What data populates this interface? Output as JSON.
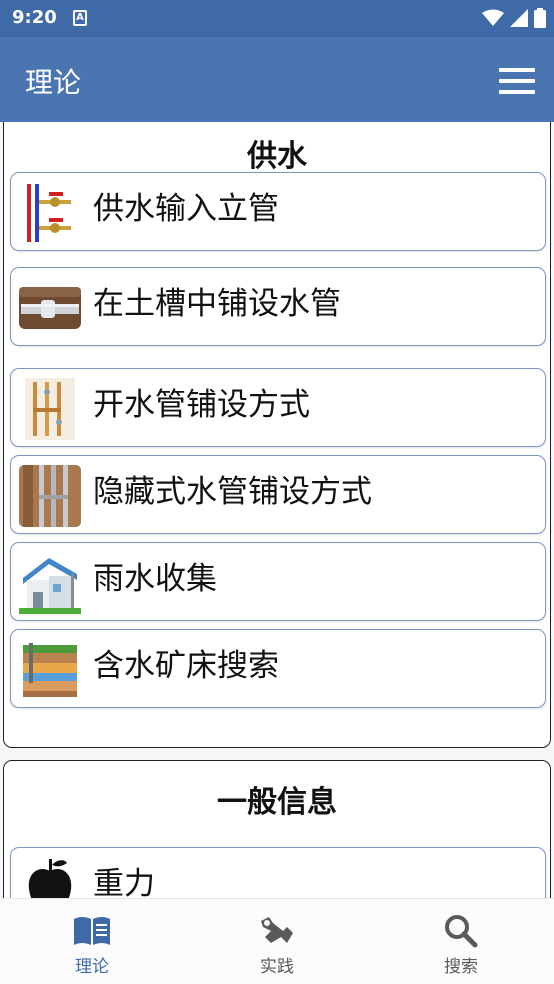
{
  "status_bar": {
    "time": "9:20",
    "notification_glyph": "A"
  },
  "app_bar": {
    "title": "理论",
    "menu_icon": "hamburger-menu-icon"
  },
  "sections": [
    {
      "title": "供水",
      "items": [
        {
          "label": "供水输入立管",
          "icon": "valve-pipes-icon"
        },
        {
          "label": "在土槽中铺设水管",
          "icon": "trench-pipe-icon"
        },
        {
          "label": "开水管铺设方式",
          "icon": "open-pipes-icon"
        },
        {
          "label": "隐藏式水管铺设方式",
          "icon": "hidden-pipes-icon"
        },
        {
          "label": "雨水收集",
          "icon": "rain-house-icon"
        },
        {
          "label": "含水矿床搜索",
          "icon": "aquifer-layers-icon"
        }
      ]
    },
    {
      "title": "一般信息",
      "items": [
        {
          "label": "重力",
          "icon": "apple-icon"
        }
      ]
    }
  ],
  "bottom_nav": [
    {
      "label": "理论",
      "icon": "book-icon",
      "active": true
    },
    {
      "label": "实践",
      "icon": "tools-icon",
      "active": false
    },
    {
      "label": "搜索",
      "icon": "search-icon",
      "active": false
    }
  ],
  "colors": {
    "primary": "#4a75b1",
    "status_bar": "#3e6aa8",
    "item_border": "#7e95c6"
  }
}
